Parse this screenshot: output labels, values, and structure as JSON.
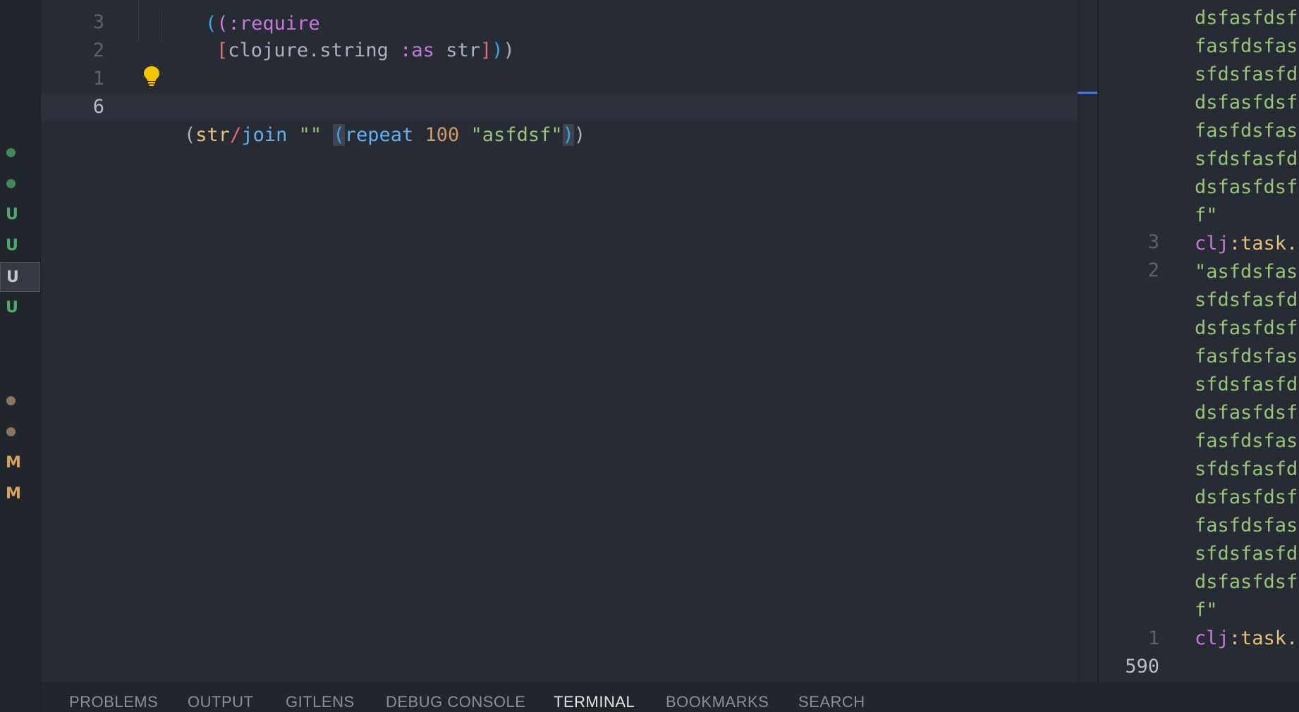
{
  "editor": {
    "partial_top_line": "(:require",
    "line_numbers": [
      "3",
      "2",
      "1",
      "6"
    ],
    "lines": {
      "require_vec_open": "[",
      "require_ns": "clojure.string",
      "require_kw": ":as",
      "require_alias": "str",
      "require_vec_close": "]",
      "require_close_parens_blue": ")",
      "require_close_parens": ")",
      "expr_open": "(",
      "expr_fn_ns": "str",
      "expr_fn_slash": "/",
      "expr_fn_name": "join",
      "expr_empty_str": "\"\"",
      "expr_inner_open": "(",
      "expr_repeat": "repeat",
      "expr_num": "100",
      "expr_str": "\"asfdsf\"",
      "expr_inner_close": ")",
      "expr_close": ")"
    },
    "bulb_icon": "lightbulb-icon"
  },
  "scm_gutter": {
    "marks": [
      {
        "kind": "dot",
        "color": "#3f8a5c"
      },
      {
        "kind": "dot",
        "color": "#3f8a5c"
      },
      {
        "kind": "letter",
        "text": "U",
        "color": "#4fa96e"
      },
      {
        "kind": "letter",
        "text": "U",
        "color": "#4fa96e"
      },
      {
        "kind": "letter",
        "text": "U",
        "color": "#c4c8cf",
        "selected": true
      },
      {
        "kind": "letter",
        "text": "U",
        "color": "#4fa96e"
      },
      {
        "kind": "dot",
        "color": "#8a7560"
      },
      {
        "kind": "dot",
        "color": "#8a7560"
      },
      {
        "kind": "letter",
        "text": "M",
        "color": "#d7a55c"
      },
      {
        "kind": "letter",
        "text": "M",
        "color": "#d7a55c"
      }
    ]
  },
  "output_pane": {
    "numbers": [
      "3",
      "2",
      "1",
      "590"
    ],
    "lines": [
      "dsfasfdsfa",
      "fasfdsfasf",
      "sfdsfasfds",
      "dsfasfdsfa",
      "fasfdsfasf",
      "sfdsfasfds",
      "dsfasfdsfa",
      "f\"",
      "clj:task.t",
      "\"asfdsfasf",
      "sfdsfasfds",
      "dsfasfdsfa",
      "fasfdsfasf",
      "sfdsfasfds",
      "dsfasfdsfa",
      "fasfdsfasf",
      "sfdsfasfds",
      "dsfasfdsfa",
      "fasfdsfasf",
      "sfdsfasfds",
      "dsfasfdsfa",
      "f\"",
      "clj:task.t"
    ],
    "prompt_ns": "clj",
    "prompt_rest": ":task.t"
  },
  "panel": {
    "tabs": [
      "PROBLEMS",
      "OUTPUT",
      "GITLENS",
      "DEBUG CONSOLE",
      "TERMINAL",
      "BOOKMARKS",
      "SEARCH"
    ],
    "active_tab": "TERMINAL"
  },
  "colors": {
    "background": "#272b34",
    "string_green": "#98c379",
    "keyword_purple": "#c678dd",
    "fn_yellow": "#e5c07b",
    "accent_blue": "#4d78cc"
  }
}
